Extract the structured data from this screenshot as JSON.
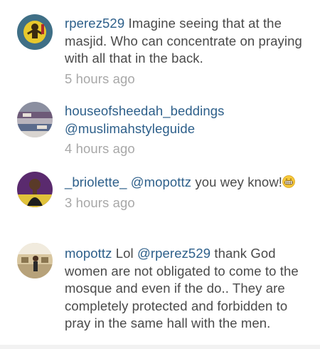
{
  "comments": [
    {
      "username": "rperez529",
      "text": "Imagine seeing that at the masjid. Who can concentrate on praying with all that in the back.",
      "time": "5 hours ago"
    },
    {
      "username": "houseofsheedah_beddings",
      "mention": "@muslimahstyleguide",
      "time": "4 hours ago"
    },
    {
      "username": "_briolette_",
      "mention": "@mopottz",
      "text": "you wey know!",
      "emoji": "grinning-face-emoji",
      "time": "3 hours ago"
    },
    {
      "username": "mopottz",
      "text_before": "Lol",
      "mention": "@rperez529",
      "text_after": "thank God women are not obligated to come to the mosque and even if the do.. They are completely protected and forbidden to pray in the same hall with the men."
    }
  ],
  "colors": {
    "username": "#2d5f8a",
    "body_text": "#4a4a4a",
    "timestamp": "#a8a8a8",
    "background": "#ffffff"
  }
}
